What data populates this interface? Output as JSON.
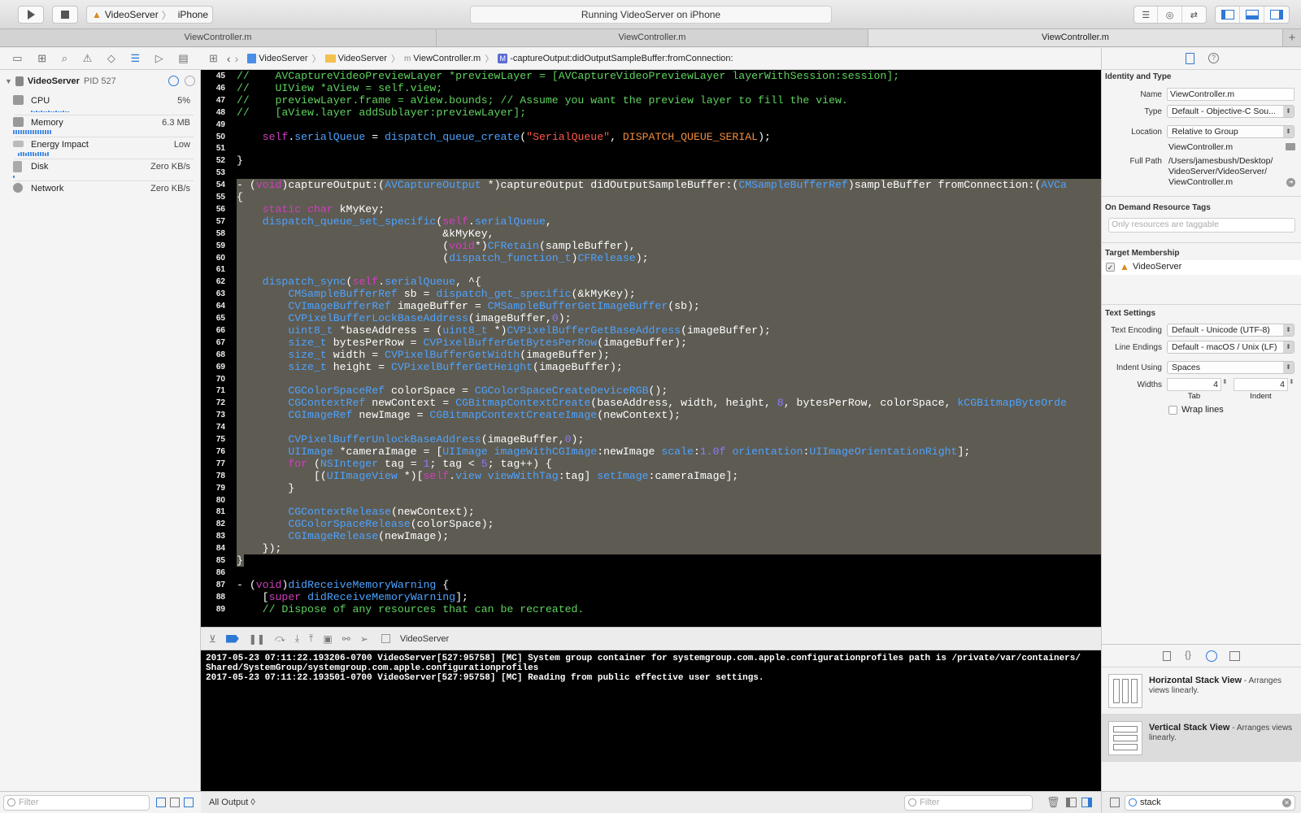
{
  "toolbar": {
    "scheme_name": "VideoServer",
    "device_name": "iPhone",
    "activity_status": "Running VideoServer on iPhone"
  },
  "tabs": [
    {
      "label": "ViewController.m"
    },
    {
      "label": "ViewController.m"
    },
    {
      "label": "ViewController.m"
    }
  ],
  "debug_navigator": {
    "process_name": "VideoServer",
    "process_pid": "PID 527",
    "gauges": [
      {
        "label": "CPU",
        "value": "5%"
      },
      {
        "label": "Memory",
        "value": "6.3 MB"
      },
      {
        "label": "Energy Impact",
        "value": "Low"
      },
      {
        "label": "Disk",
        "value": "Zero KB/s"
      },
      {
        "label": "Network",
        "value": "Zero KB/s"
      }
    ],
    "filter_placeholder": "Filter"
  },
  "jump_bar": {
    "crumbs": [
      "VideoServer",
      "VideoServer",
      "ViewController.m",
      "-captureOutput:didOutputSampleBuffer:fromConnection:"
    ]
  },
  "editor": {
    "lines": [
      {
        "n": "45",
        "t": "//    AVCaptureVideoPreviewLayer *previewLayer = [AVCaptureVideoPreviewLayer layerWithSession:session];"
      },
      {
        "n": "46",
        "t": "//    UIView *aView = self.view;"
      },
      {
        "n": "47",
        "t": "//    previewLayer.frame = aView.bounds; // Assume you want the preview layer to fill the view."
      },
      {
        "n": "48",
        "t": "//    [aView.layer addSublayer:previewLayer];"
      },
      {
        "n": "49",
        "t": ""
      },
      {
        "n": "50",
        "t": "    self.serialQueue = dispatch_queue_create(\"SerialQueue\", DISPATCH_QUEUE_SERIAL);"
      },
      {
        "n": "51",
        "t": ""
      },
      {
        "n": "52",
        "t": "}"
      },
      {
        "n": "53",
        "t": ""
      },
      {
        "n": "54",
        "t": "- (void)captureOutput:(AVCaptureOutput *)captureOutput didOutputSampleBuffer:(CMSampleBufferRef)sampleBuffer fromConnection:(AVCa"
      },
      {
        "n": "55",
        "t": "{"
      },
      {
        "n": "56",
        "t": "    static char kMyKey;"
      },
      {
        "n": "57",
        "t": "    dispatch_queue_set_specific(self.serialQueue,"
      },
      {
        "n": "58",
        "t": "                                &kMyKey,"
      },
      {
        "n": "59",
        "t": "                                (void*)CFRetain(sampleBuffer),"
      },
      {
        "n": "60",
        "t": "                                (dispatch_function_t)CFRelease);"
      },
      {
        "n": "61",
        "t": ""
      },
      {
        "n": "62",
        "t": "    dispatch_sync(self.serialQueue, ^{"
      },
      {
        "n": "63",
        "t": "        CMSampleBufferRef sb = dispatch_get_specific(&kMyKey);"
      },
      {
        "n": "64",
        "t": "        CVImageBufferRef imageBuffer = CMSampleBufferGetImageBuffer(sb);"
      },
      {
        "n": "65",
        "t": "        CVPixelBufferLockBaseAddress(imageBuffer,0);"
      },
      {
        "n": "66",
        "t": "        uint8_t *baseAddress = (uint8_t *)CVPixelBufferGetBaseAddress(imageBuffer);"
      },
      {
        "n": "67",
        "t": "        size_t bytesPerRow = CVPixelBufferGetBytesPerRow(imageBuffer);"
      },
      {
        "n": "68",
        "t": "        size_t width = CVPixelBufferGetWidth(imageBuffer);"
      },
      {
        "n": "69",
        "t": "        size_t height = CVPixelBufferGetHeight(imageBuffer);"
      },
      {
        "n": "70",
        "t": ""
      },
      {
        "n": "71",
        "t": "        CGColorSpaceRef colorSpace = CGColorSpaceCreateDeviceRGB();"
      },
      {
        "n": "72",
        "t": "        CGContextRef newContext = CGBitmapContextCreate(baseAddress, width, height, 8, bytesPerRow, colorSpace, kCGBitmapByteOrde"
      },
      {
        "n": "73",
        "t": "        CGImageRef newImage = CGBitmapContextCreateImage(newContext);"
      },
      {
        "n": "74",
        "t": ""
      },
      {
        "n": "75",
        "t": "        CVPixelBufferUnlockBaseAddress(imageBuffer,0);"
      },
      {
        "n": "76",
        "t": "        UIImage *cameraImage = [UIImage imageWithCGImage:newImage scale:1.0f orientation:UIImageOrientationRight];"
      },
      {
        "n": "77",
        "t": "        for (NSInteger tag = 1; tag < 5; tag++) {"
      },
      {
        "n": "78",
        "t": "            [(UIImageView *)[self.view viewWithTag:tag] setImage:cameraImage];"
      },
      {
        "n": "79",
        "t": "        }"
      },
      {
        "n": "80",
        "t": ""
      },
      {
        "n": "81",
        "t": "        CGContextRelease(newContext);"
      },
      {
        "n": "82",
        "t": "        CGColorSpaceRelease(colorSpace);"
      },
      {
        "n": "83",
        "t": "        CGImageRelease(newImage);"
      },
      {
        "n": "84",
        "t": "    });"
      },
      {
        "n": "85",
        "t": "}"
      },
      {
        "n": "86",
        "t": ""
      },
      {
        "n": "87",
        "t": "- (void)didReceiveMemoryWarning {"
      },
      {
        "n": "88",
        "t": "    [super didReceiveMemoryWarning];"
      },
      {
        "n": "89",
        "t": "    // Dispose of any resources that can be recreated."
      }
    ]
  },
  "debug_bar": {
    "target": "VideoServer"
  },
  "console": {
    "lines": [
      "2017-05-23 07:11:22.193206-0700 VideoServer[527:95758] [MC] System group container for systemgroup.com.apple.configurationprofiles path is /private/var/containers/",
      "Shared/SystemGroup/systemgroup.com.apple.configurationprofiles",
      "2017-05-23 07:11:22.193501-0700 VideoServer[527:95758] [MC] Reading from public effective user settings."
    ],
    "output_selector": "All Output ◊",
    "filter_placeholder": "Filter"
  },
  "inspector": {
    "identity_title": "Identity and Type",
    "name_label": "Name",
    "name_value": "ViewController.m",
    "type_label": "Type",
    "type_value": "Default - Objective-C Sou...",
    "location_label": "Location",
    "location_value": "Relative to Group",
    "location_file": "ViewController.m",
    "fullpath_label": "Full Path",
    "fullpath_lines": [
      "/Users/jamesbush/Desktop/",
      "VideoServer/VideoServer/",
      "ViewController.m"
    ],
    "odr_title": "On Demand Resource Tags",
    "odr_placeholder": "Only resources are taggable",
    "target_title": "Target Membership",
    "target_name": "VideoServer",
    "text_title": "Text Settings",
    "encoding_label": "Text Encoding",
    "encoding_value": "Default - Unicode (UTF-8)",
    "endings_label": "Line Endings",
    "endings_value": "Default - macOS / Unix (LF)",
    "indent_label": "Indent Using",
    "indent_value": "Spaces",
    "widths_label": "Widths",
    "tab_width": "4",
    "indent_width": "4",
    "tab_caption": "Tab",
    "indent_caption": "Indent",
    "wrap_label": "Wrap lines"
  },
  "library": {
    "items": [
      {
        "title": "Horizontal Stack View",
        "desc": " - Arranges views linearly."
      },
      {
        "title": "Vertical Stack View",
        "desc": " - Arranges views linearly."
      }
    ],
    "search_value": "stack"
  },
  "colors": {
    "comment": "#5fd25f",
    "keyword": "#d13fbf",
    "string": "#ff5a4c",
    "type": "#4da3ff",
    "number": "#8d7aff",
    "macro": "#f08b3c",
    "selection": "#5e5b52"
  }
}
